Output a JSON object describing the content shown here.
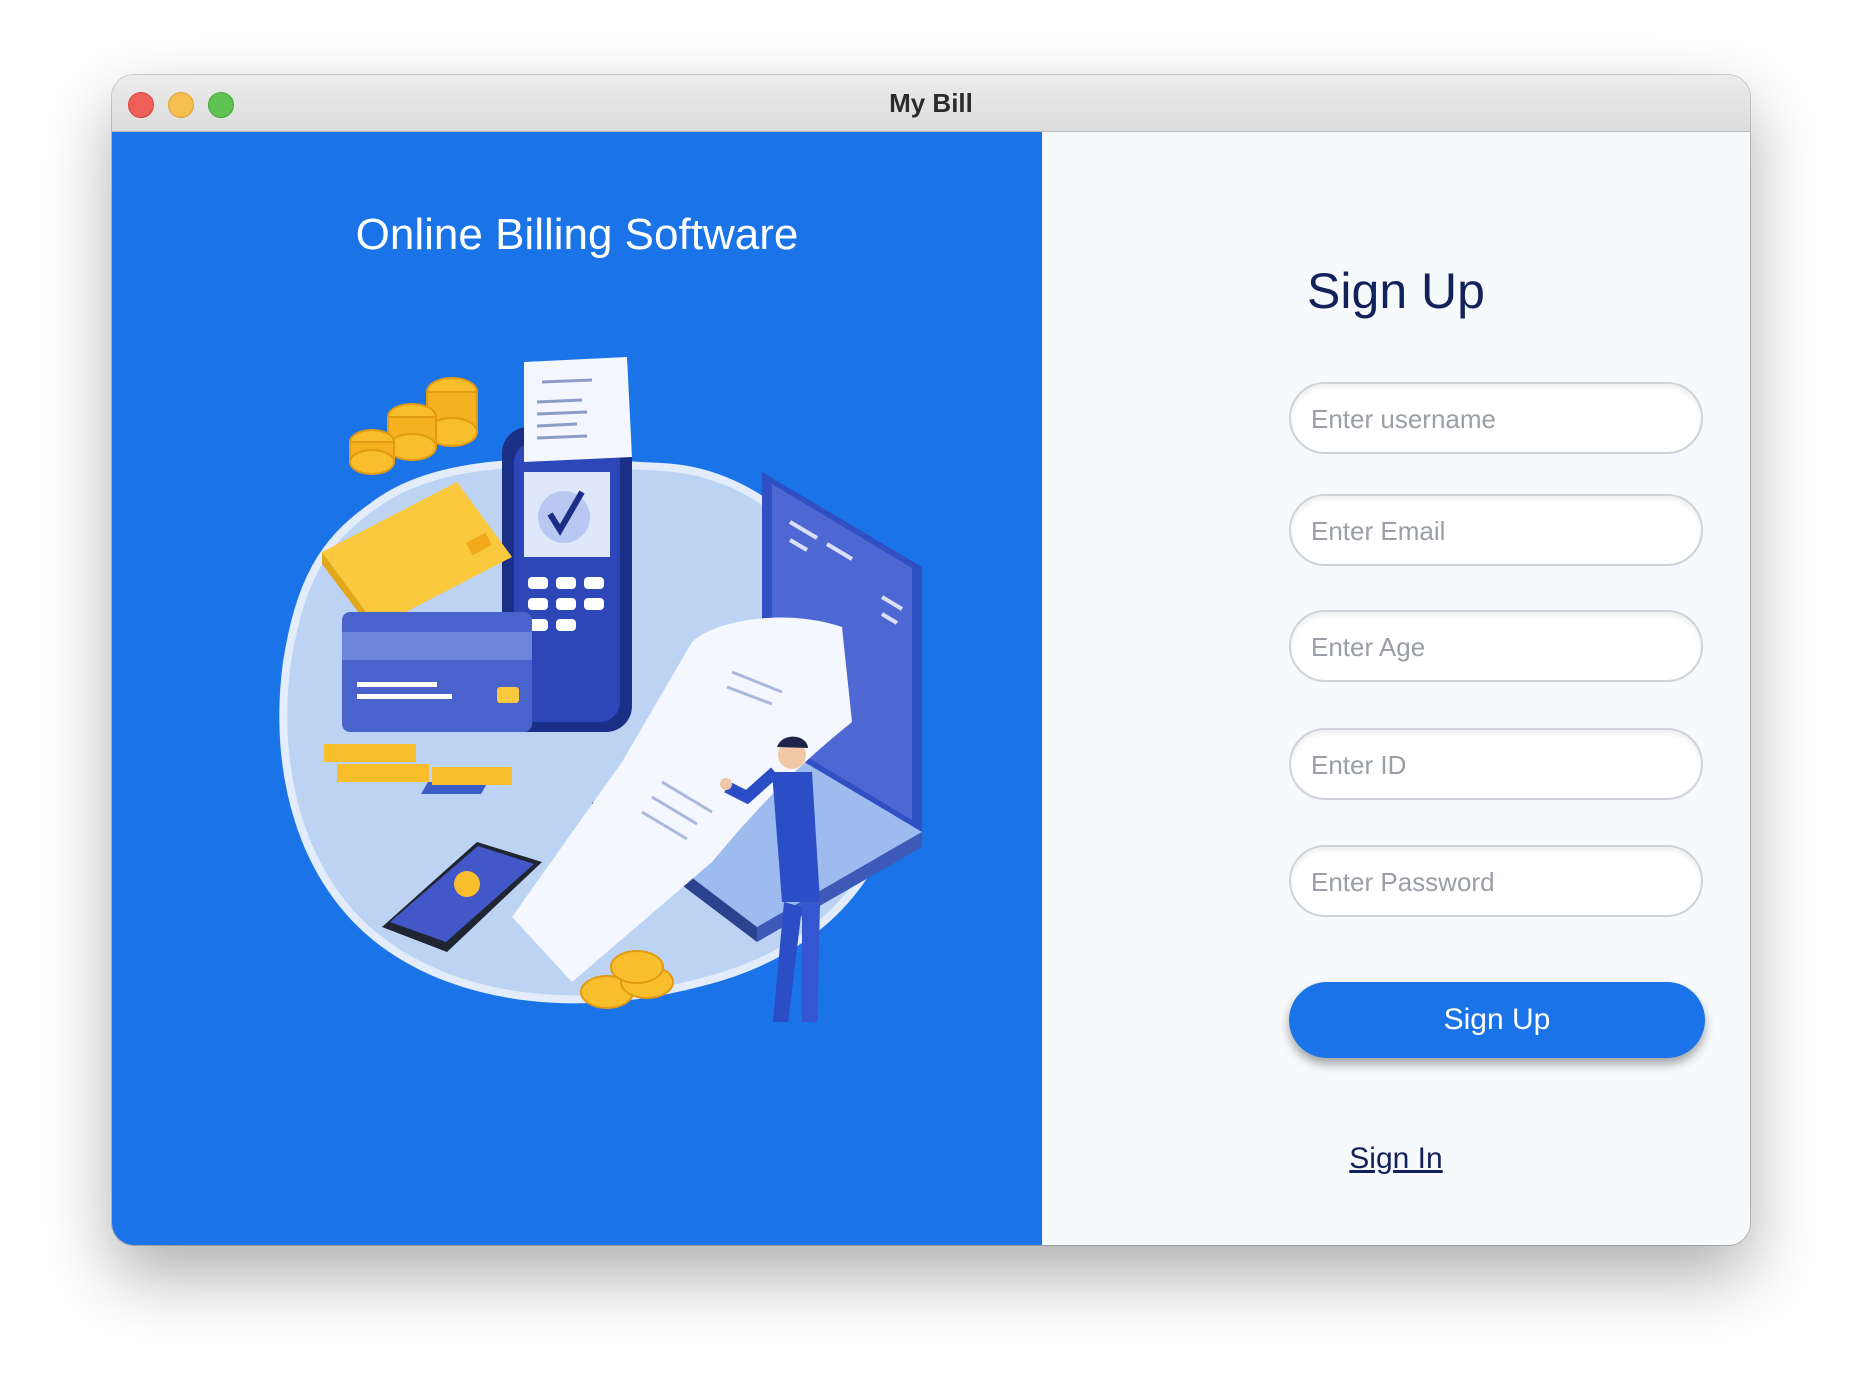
{
  "window": {
    "title": "My Bill"
  },
  "left_panel": {
    "title": "Online Billing Software",
    "background_color": "#1a74e8"
  },
  "signup": {
    "heading": "Sign Up",
    "fields": {
      "username_placeholder": "Enter username",
      "email_placeholder": "Enter Email",
      "age_placeholder": "Enter Age",
      "id_placeholder": "Enter ID",
      "password_placeholder": "Enter Password"
    },
    "submit_label": "Sign Up",
    "signin_link": "Sign In"
  },
  "colors": {
    "accent": "#1a74e8",
    "heading": "#13225a",
    "panel_background": "#f7fafd"
  }
}
